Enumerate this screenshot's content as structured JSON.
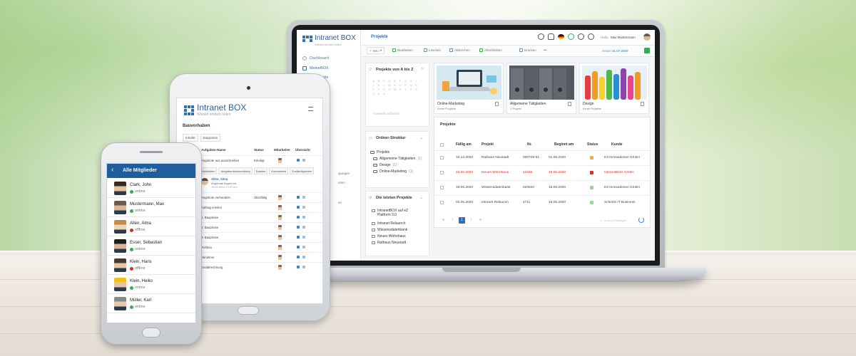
{
  "laptop": {
    "logo": {
      "title": "Intranet BOX",
      "subtitle": "Wissen einfach teilen"
    },
    "sidebar": {
      "items": [
        {
          "label": "Dashboard",
          "icon": "dashboard-icon"
        },
        {
          "label": "MeineBOX",
          "icon": "box-icon"
        }
      ],
      "sub_active": "Projekte",
      "fragments": [
        "igungen",
        "eiten",
        "en"
      ]
    },
    "topbar": {
      "page_title": "Projekte",
      "hello": "Hallo,",
      "user": "Max Mustermann"
    },
    "toolbar": {
      "new": "Neu",
      "edit": "Bearbeiten",
      "delete": "Löschen",
      "cancel": "Abbrechen",
      "done": "Abschließen",
      "print": "Drucken",
      "more": "•••",
      "date_label": "Heute:",
      "date": "31.07.2020"
    },
    "panel_az": {
      "title": "Projekte von A bis Z",
      "letters": [
        "A",
        "B",
        "C",
        "D",
        "E",
        "F",
        "G",
        "H",
        "I",
        "J",
        "K",
        "L",
        "M",
        "N",
        "O",
        "P",
        "Q",
        "R",
        "S",
        "T",
        "U",
        "V",
        "W",
        "X",
        "Y",
        "Z",
        "Ä",
        "Ö",
        "Ü",
        "#"
      ],
      "more": "Auswahl aufheben"
    },
    "panel_folders": {
      "title": "Ordner-Struktur",
      "items": [
        "Projekte",
        "Allgemeine Tätigkeiten",
        "Design",
        "Online-Marketing"
      ],
      "counts": [
        "",
        "(1)",
        "(1)",
        "(1)"
      ]
    },
    "panel_recent": {
      "title": "Die letzten Projekte",
      "items": [
        "IntranetBOX auf eZ Platform 3.0",
        "Intranet Relaunch",
        "Wissensdatenbank",
        "Neues Wohnhaus",
        "Rathaus Neustadt"
      ]
    },
    "cards": [
      {
        "title": "Online-Marketing",
        "sub": "Keine Projekte"
      },
      {
        "title": "Allgemeine Tätigkeiten",
        "sub": "1 Projekt"
      },
      {
        "title": "Design",
        "sub": "Keine Projekte"
      }
    ],
    "projects": {
      "title": "Projekte",
      "columns": [
        "Fällig am",
        "Projekt",
        "Nr.",
        "Beginnt am",
        "Status",
        "Kunde"
      ],
      "rows": [
        {
          "due": "15.12.2020",
          "name": "Rathaus Neustadt",
          "nr": "000729-01",
          "start": "01.09.2020",
          "customer": "K3 Innovationen GmbH",
          "alert": false,
          "status_color": "#f2b01e"
        },
        {
          "due": "23.06.2020",
          "name": "Neues Wohnhaus",
          "nr": "12345",
          "start": "16.06.2020",
          "customer": "IntranetBOX GmbH",
          "alert": true,
          "status_color": "#d0312d"
        },
        {
          "due": "16.06.2020",
          "name": "Wissensdatenbank",
          "nr": "020620",
          "start": "15.06.2020",
          "customer": "K3 Innovationen GmbH",
          "alert": false,
          "status_color": "#9fd39c"
        },
        {
          "due": "02.06.2020",
          "name": "Intranet Relaunch",
          "nr": "4711",
          "start": "18.05.2020",
          "customer": "Schmitz IT Business",
          "alert": false,
          "status_color": "#9fd39c"
        }
      ],
      "pager": {
        "prev_first": "«",
        "prev": "‹",
        "current": "1",
        "next": "›",
        "last": "»"
      },
      "pager_info": "1 - 4 von 4 Einträgen"
    }
  },
  "tablet": {
    "logo": {
      "title": "Intranet BOX",
      "subtitle": "Wissen einfach teilen"
    },
    "section": "Bauvorhaben",
    "tabs": [
      "Inhalte",
      "Diagramm"
    ],
    "columns": [
      "Aufgaben-Name",
      "Status",
      "Mitarbeiter",
      "Übersicht"
    ],
    "rows": [
      {
        "name": "Angebote aus ausschreiben",
        "status": "Erledigt"
      },
      {
        "name": "Angebote verhandeln",
        "status": "Überfällig"
      },
      {
        "name": "Auftrag erteilen",
        "status": ""
      },
      {
        "name": "1. Bauphase",
        "status": ""
      },
      {
        "name": "2. Bauphase",
        "status": ""
      },
      {
        "name": "3. Bauphase",
        "status": ""
      },
      {
        "name": "Rohbau",
        "status": ""
      },
      {
        "name": "Abnahme",
        "status": ""
      },
      {
        "name": "Endabrechnung",
        "status": ""
      }
    ],
    "subtabs": [
      "Aktivitäten",
      "Aufgabenbeschreibung",
      "Dateien",
      "Kommentar",
      "Zuständigkeiten"
    ],
    "comment": {
      "name": "Allen, Alma",
      "text": "Angebote liegen vor.",
      "date": "19.09.2016 17:00 Uhr"
    }
  },
  "phone": {
    "title": "Alle Mitglieder",
    "members": [
      {
        "name": "Clark, John",
        "status": "online",
        "color": "#3aaa57"
      },
      {
        "name": "Mustermann, Max",
        "status": "online",
        "color": "#3aaa57"
      },
      {
        "name": "Allen, Alma",
        "status": "offline",
        "color": "#d0312d"
      },
      {
        "name": "Esser, Sebastian",
        "status": "online",
        "color": "#3aaa57"
      },
      {
        "name": "Klein, Hans",
        "status": "offline",
        "color": "#d0312d"
      },
      {
        "name": "Klein, Heiko",
        "status": "online",
        "color": "#3aaa57"
      },
      {
        "name": "Müller, Karl",
        "status": "online",
        "color": "#3aaa57"
      }
    ]
  },
  "colors": {
    "brand_blue": "#2f6fb0",
    "header_blue": "#1f5e9c",
    "online": "#3aaa57",
    "offline": "#d0312d"
  }
}
